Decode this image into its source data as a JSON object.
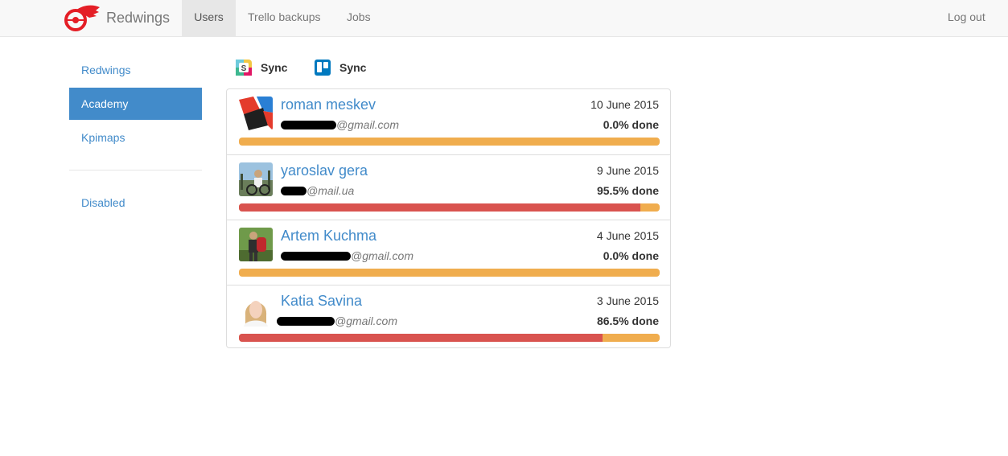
{
  "navbar": {
    "brand": "Redwings",
    "items": [
      {
        "label": "Users",
        "active": true
      },
      {
        "label": "Trello backups",
        "active": false
      },
      {
        "label": "Jobs",
        "active": false
      }
    ],
    "logout": "Log out"
  },
  "sidebar": {
    "items": [
      {
        "label": "Redwings",
        "active": false
      },
      {
        "label": "Academy",
        "active": true
      },
      {
        "label": "Kpimaps",
        "active": false
      }
    ],
    "disabled_label": "Disabled"
  },
  "sync": {
    "slack_label": "Sync",
    "trello_label": "Sync"
  },
  "users": [
    {
      "name": "roman meskev",
      "date": "10 June 2015",
      "email_domain": "@gmail.com",
      "progress_text": "0.0% done",
      "progress": 0.0
    },
    {
      "name": "yaroslav gera",
      "date": "9 June 2015",
      "email_domain": "@mail.ua",
      "progress_text": "95.5% done",
      "progress": 95.5
    },
    {
      "name": "Artem Kuchma",
      "date": "4 June 2015",
      "email_domain": "@gmail.com",
      "progress_text": "0.0% done",
      "progress": 0.0
    },
    {
      "name": "Katia Savina",
      "date": "3 June 2015",
      "email_domain": "@gmail.com",
      "progress_text": "86.5% done",
      "progress": 86.5
    }
  ],
  "colors": {
    "accent": "#428bca",
    "progress_done": "#d9534f",
    "progress_remaining": "#f0ad4e"
  },
  "icons": {
    "brand": "redwings-logo-icon",
    "slack": "slack-icon",
    "trello": "trello-icon"
  }
}
